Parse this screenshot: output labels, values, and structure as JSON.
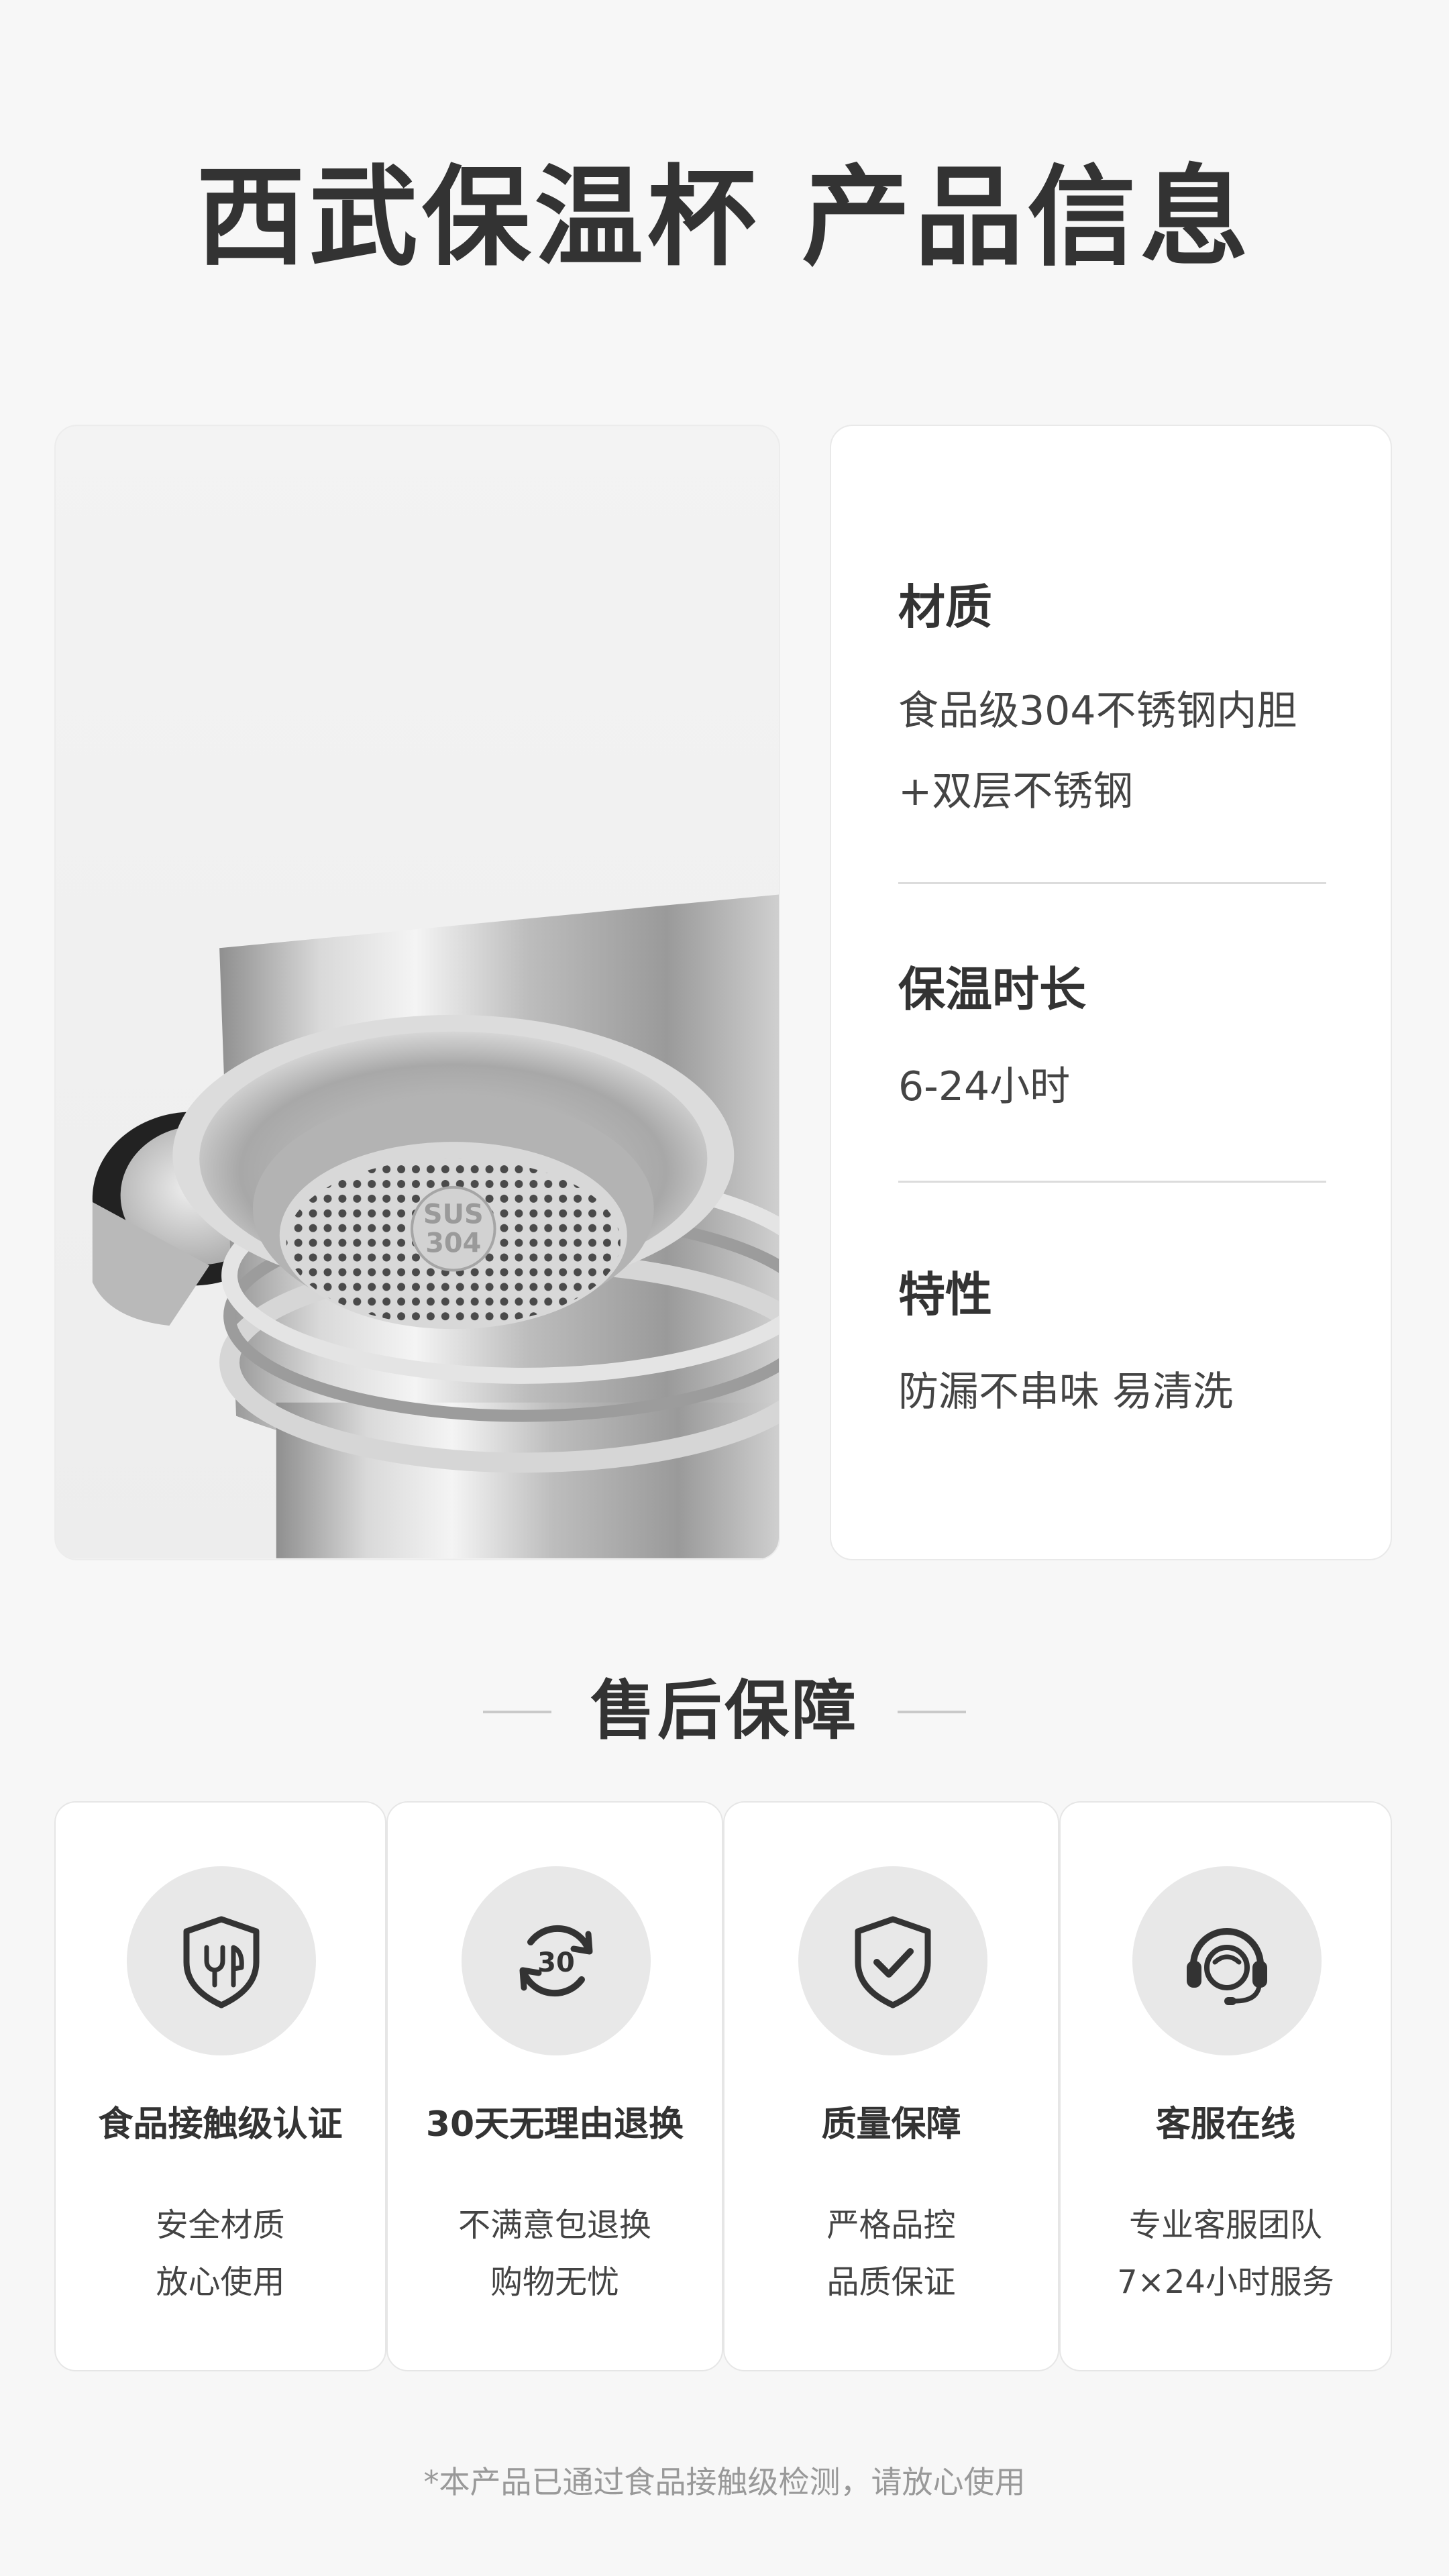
{
  "page": {
    "title": "西武保温杯 产品信息",
    "accent_color": "#333333",
    "background_color": "#f7f7f7"
  },
  "product_photo": {
    "engraving_line1": "SUS",
    "engraving_line2": "304"
  },
  "specs": [
    {
      "label": "材质",
      "value_lines": [
        "食品级304不锈钢内胆",
        "+双层不锈钢"
      ]
    },
    {
      "label": "保温时长",
      "value_lines": [
        "6-24小时"
      ]
    },
    {
      "label": "特性",
      "value_lines": [
        "防漏不串味 易清洗"
      ]
    }
  ],
  "after_sales": {
    "title": "售后保障",
    "items": [
      {
        "icon": "food-safe-shield-icon",
        "title": "食品接触级认证",
        "lines": [
          "安全材质",
          "放心使用"
        ]
      },
      {
        "icon": "30-day-return-icon",
        "icon_text": "30",
        "title": "30天无理由退换",
        "lines": [
          "不满意包退换",
          "购物无忧"
        ]
      },
      {
        "icon": "quality-shield-check-icon",
        "title": "质量保障",
        "lines": [
          "严格品控",
          "品质保证"
        ]
      },
      {
        "icon": "customer-service-headset-icon",
        "title": "客服在线",
        "lines": [
          "专业客服团队",
          "7×24小时服务"
        ]
      }
    ]
  },
  "footer": {
    "note": "*本产品已通过食品接触级检测，请放心使用"
  }
}
